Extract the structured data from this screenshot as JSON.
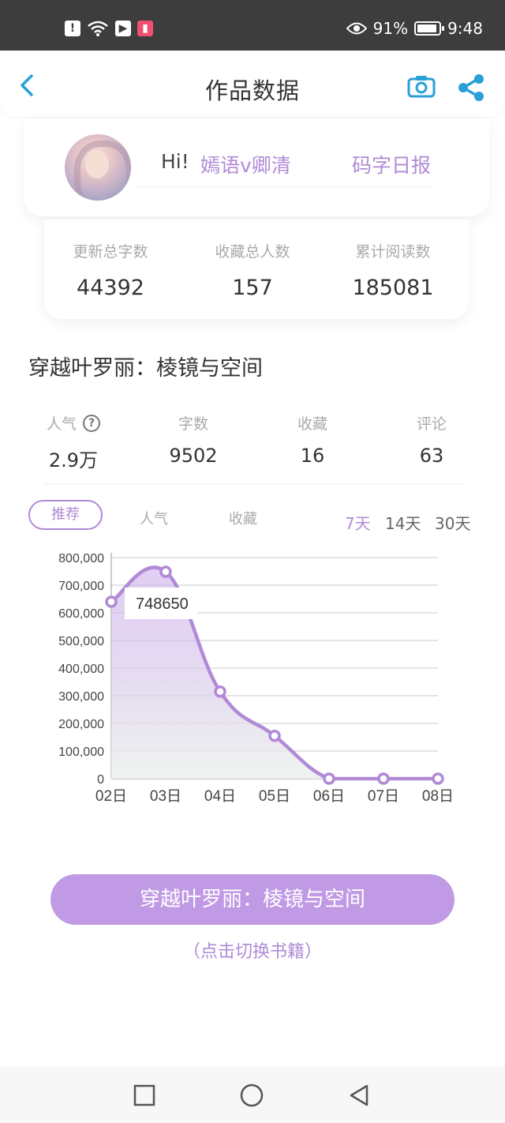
{
  "status_bar": {
    "battery": "91%",
    "time": "9:48"
  },
  "header": {
    "title": "作品数据"
  },
  "profile": {
    "greeting": "Hi!",
    "author": "嫣语v卿清",
    "daily_report": "码字日报"
  },
  "totals": [
    {
      "label": "更新总字数",
      "value": "44392"
    },
    {
      "label": "收藏总人数",
      "value": "157"
    },
    {
      "label": "累计阅读数",
      "value": "185081"
    }
  ],
  "book": {
    "title": "穿越叶罗丽：棱镜与空间"
  },
  "metrics": [
    {
      "label": "人气",
      "value": "2.9万"
    },
    {
      "label": "字数",
      "value": "9502"
    },
    {
      "label": "收藏",
      "value": "16"
    },
    {
      "label": "评论",
      "value": "63"
    }
  ],
  "tabs": {
    "recommend": "推荐",
    "popularity": "人气",
    "favorites": "收藏"
  },
  "ranges": {
    "d7": "7天",
    "d14": "14天",
    "d30": "30天"
  },
  "colors": {
    "accent": "#b08ad6",
    "button": "#c09ae4"
  },
  "chart_data": {
    "type": "area",
    "categories": [
      "02日",
      "03日",
      "04日",
      "05日",
      "06日",
      "07日",
      "08日"
    ],
    "values": [
      640000,
      748650,
      315000,
      155000,
      0,
      0,
      0
    ],
    "y_ticks": [
      "0",
      "100,000",
      "200,000",
      "300,000",
      "400,000",
      "500,000",
      "600,000",
      "700,000",
      "800,000"
    ],
    "ylim": [
      0,
      800000
    ],
    "tooltip": "748650",
    "grid": true
  },
  "actions": {
    "switch_book": "穿越叶罗丽：棱镜与空间",
    "switch_hint": "（点击切换书籍）"
  }
}
